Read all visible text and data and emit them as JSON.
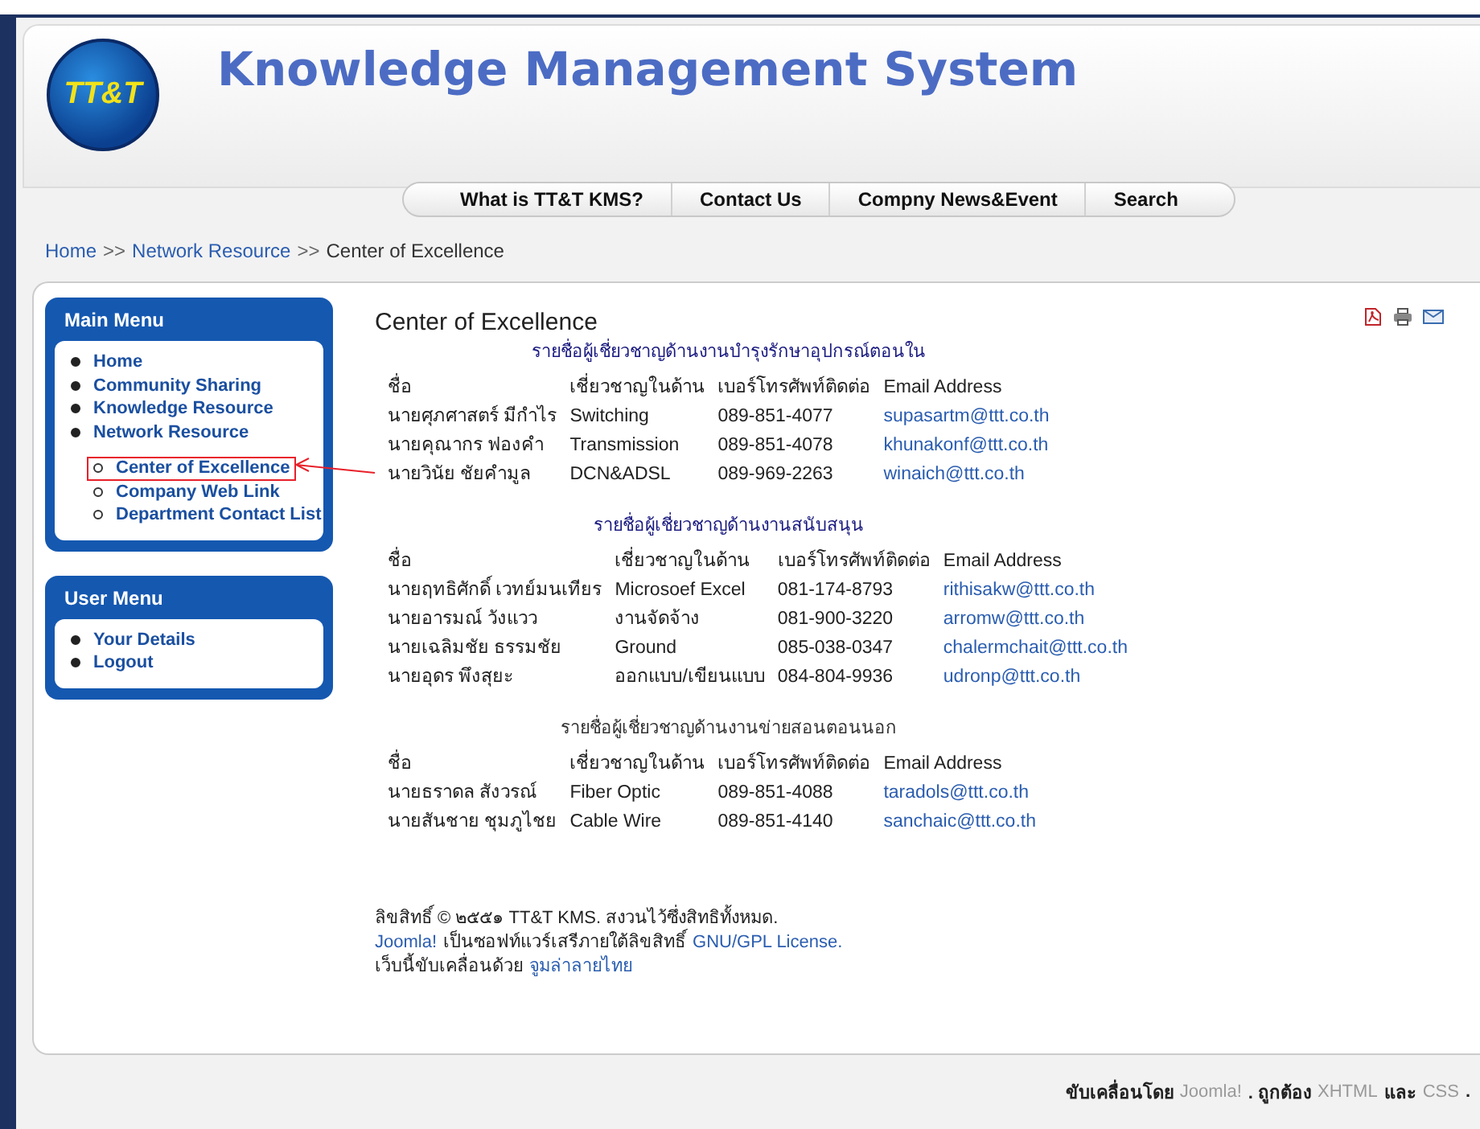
{
  "header": {
    "logo_text": "TT&T",
    "title": "Knowledge Management System"
  },
  "nav": [
    {
      "label": "What is TT&T KMS?"
    },
    {
      "label": "Contact Us"
    },
    {
      "label": "Compny News&Event"
    },
    {
      "label": "Search"
    }
  ],
  "breadcrumb": {
    "separator": ">>",
    "items": [
      {
        "label": "Home",
        "link": true
      },
      {
        "label": "Network Resource",
        "link": true
      },
      {
        "label": "Center of Excellence",
        "link": false
      }
    ]
  },
  "main_menu": {
    "title": "Main Menu",
    "items": [
      {
        "label": "Home",
        "selected": false
      },
      {
        "label": "Community Sharing",
        "selected": false
      },
      {
        "label": "Knowledge Resource",
        "selected": false
      },
      {
        "label": "Network Resource",
        "selected": false,
        "children": [
          {
            "label": "Center of Excellence",
            "selected": true
          },
          {
            "label": "Company Web Link",
            "selected": false
          },
          {
            "label": "Department Contact List",
            "selected": false
          }
        ]
      }
    ]
  },
  "user_menu": {
    "title": "User Menu",
    "items": [
      {
        "label": "Your Details",
        "selected": false
      },
      {
        "label": "Logout",
        "selected": false
      }
    ]
  },
  "article": {
    "title": "Center of Excellence"
  },
  "sections": [
    {
      "heading": "รายชื่อผู้เชี่ยวชาญด้านงานบำรุงรักษาอุปกรณ์ตอนใน",
      "emphasized": true,
      "columns": [
        "ชื่อ",
        "เชี่ยวชาญในด้าน",
        "เบอร์โทรศัพท์ติดต่อ",
        "Email  Address"
      ],
      "rows": [
        [
          "นายศุภศาสตร์ มีกำไร",
          "Switching",
          "089-851-4077",
          "supasartm@ttt.co.th"
        ],
        [
          "นายคุณากร ฟองคำ",
          "Transmission",
          "089-851-4078",
          "khunakonf@ttt.co.th"
        ],
        [
          "นายวินัย ชัยคำมูล",
          "DCN&ADSL",
          "089-969-2263",
          "winaich@ttt.co.th"
        ]
      ]
    },
    {
      "heading": "รายชื่อผู้เชี่ยวชาญด้านงานสนับสนุน",
      "emphasized": true,
      "columns": [
        "ชื่อ",
        "เชี่ยวชาญในด้าน",
        "เบอร์โทรศัพท์ติดต่อ",
        "Email  Address"
      ],
      "rows": [
        [
          "นายฤทธิศักดิ์ เวทย์มนเทียร",
          "Microsoef Excel",
          "081-174-8793",
          "rithisakw@ttt.co.th"
        ],
        [
          "นายอารมณ์ วังแวว",
          "งานจัดจ้าง",
          "081-900-3220",
          "arromw@ttt.co.th"
        ],
        [
          "นายเฉลิมชัย ธรรมชัย",
          "Ground",
          "085-038-0347",
          "chalermchait@ttt.co.th"
        ],
        [
          "นายอุดร พึงสุยะ",
          "ออกแบบ/เขียนแบบ",
          "084-804-9936",
          "udronp@ttt.co.th"
        ]
      ]
    },
    {
      "heading": "รายชื่อผู้เชี่ยวชาญด้านงานข่ายสอนตอนนอก",
      "emphasized": false,
      "columns": [
        "ชื่อ",
        "เชี่ยวชาญในด้าน",
        "เบอร์โทรศัพท์ติดต่อ",
        "Email  Address"
      ],
      "rows": [
        [
          "นายธราดล สังวรณ์",
          "Fiber Optic",
          "089-851-4088",
          "taradols@ttt.co.th"
        ],
        [
          "นายสันชาย ชุมภูไชย",
          "Cable Wire",
          "089-851-4140",
          "sanchaic@ttt.co.th"
        ]
      ]
    }
  ],
  "footer_note": [
    [
      {
        "text": "ลิขสิทธิ์ © ๒๕๕๑ TT&T KMS. สงวนไว้ซึ่งสิทธิทั้งหมด.",
        "link": false
      }
    ],
    [
      {
        "text": "Joomla!",
        "link": true
      },
      {
        "text": "เป็นซอฟท์แวร์เสรีภายใต้ลิขสิทธิ์",
        "link": false
      },
      {
        "text": "GNU/GPL License.",
        "link": true
      }
    ],
    [
      {
        "text": "เว็บนี้ขับเคลื่อนด้วย",
        "link": false
      },
      {
        "text": "จูมล่าลายไทย",
        "link": true
      }
    ]
  ],
  "bottom_bar": [
    {
      "text": "ขับเคลื่อนโดย",
      "link": false
    },
    {
      "text": "Joomla!",
      "link": true
    },
    {
      "text": ". ถูกต้อง",
      "link": false
    },
    {
      "text": "XHTML",
      "link": true
    },
    {
      "text": "และ",
      "link": false
    },
    {
      "text": "CSS",
      "link": true
    },
    {
      "text": ".",
      "link": false
    }
  ]
}
